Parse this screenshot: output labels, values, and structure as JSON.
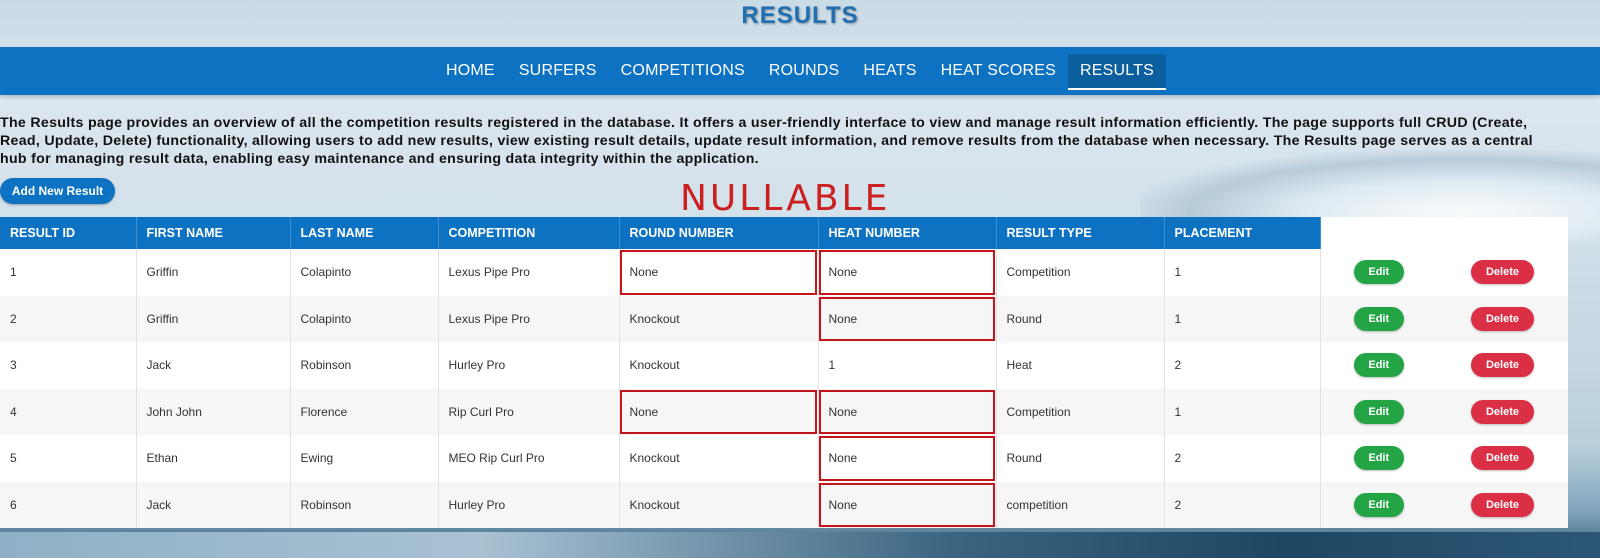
{
  "header": {
    "title": "RESULTS"
  },
  "nav": {
    "items": [
      "HOME",
      "SURFERS",
      "COMPETITIONS",
      "ROUNDS",
      "HEATS",
      "HEAT SCORES",
      "RESULTS"
    ],
    "active": "RESULTS"
  },
  "description": "The Results page provides an overview of all the competition results registered in the database. It offers a user-friendly interface to view and manage result information efficiently. The page supports full CRUD (Create, Read, Update, Delete) functionality, allowing users to add new results, view existing result details, update result information, and remove results from the database when necessary. The Results page serves as a central hub for managing result data, enabling easy maintenance and ensuring data integrity within the application.",
  "add_button_label": "Add New Result",
  "annotation": "NULLABLE",
  "table": {
    "columns": [
      "RESULT ID",
      "FIRST NAME",
      "LAST NAME",
      "COMPETITION",
      "ROUND NUMBER",
      "HEAT NUMBER",
      "RESULT TYPE",
      "PLACEMENT"
    ],
    "rows": [
      [
        "1",
        "Griffin",
        "Colapinto",
        "Lexus Pipe Pro",
        "None",
        "None",
        "Competition",
        "1"
      ],
      [
        "2",
        "Griffin",
        "Colapinto",
        "Lexus Pipe Pro",
        "Knockout",
        "None",
        "Round",
        "1"
      ],
      [
        "3",
        "Jack",
        "Robinson",
        "Hurley Pro",
        "Knockout",
        "1",
        "Heat",
        "2"
      ],
      [
        "4",
        "John John",
        "Florence",
        "Rip Curl Pro",
        "None",
        "None",
        "Competition",
        "1"
      ],
      [
        "5",
        "Ethan",
        "Ewing",
        "MEO Rip Curl Pro",
        "Knockout",
        "None",
        "Round",
        "2"
      ],
      [
        "6",
        "Jack",
        "Robinson",
        "Hurley Pro",
        "Knockout",
        "None",
        "competition",
        "2"
      ]
    ],
    "edit_label": "Edit",
    "delete_label": "Delete"
  },
  "colors": {
    "primary": "#0e72c3",
    "edit": "#23a545",
    "delete": "#db2f45",
    "annotation": "#cc1f1f"
  }
}
